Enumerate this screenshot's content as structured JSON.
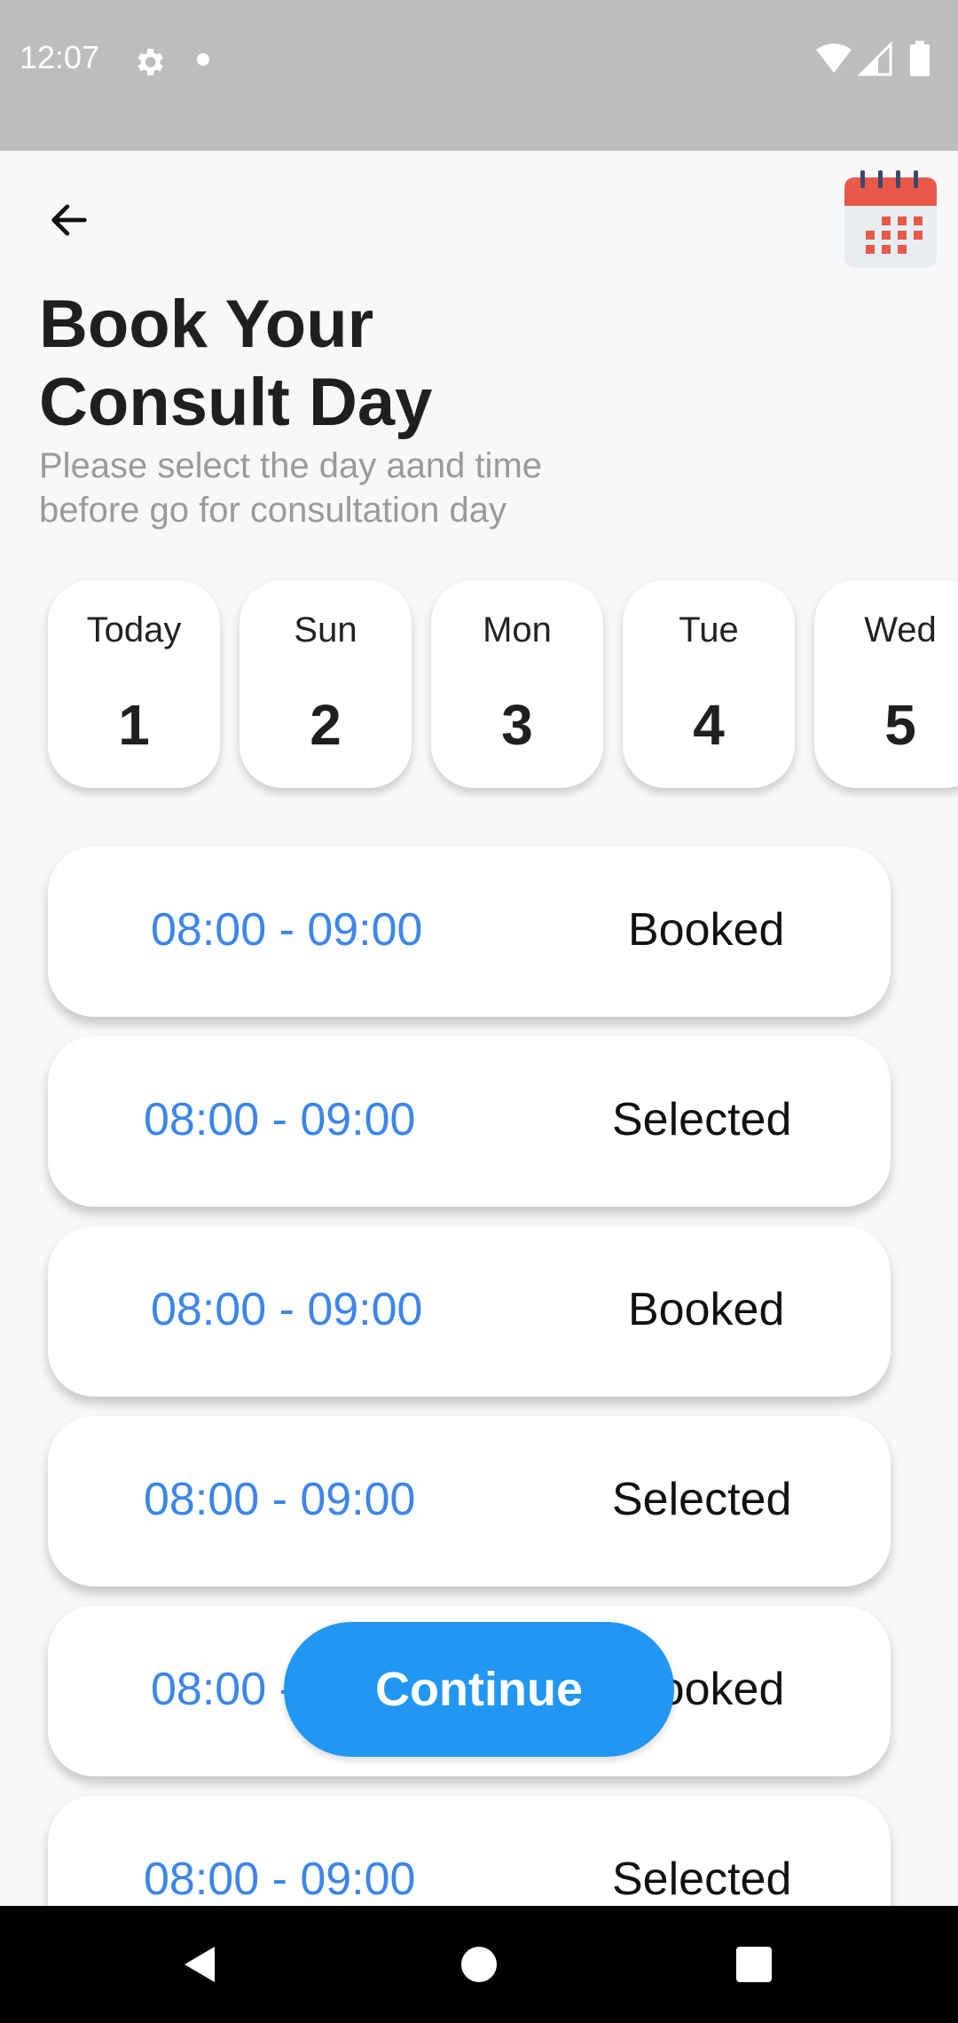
{
  "status_bar": {
    "time": "12:07",
    "icons": [
      "gear-icon",
      "notification-dot",
      "wifi-icon",
      "cell-signal-icon",
      "battery-icon"
    ]
  },
  "header": {
    "back_icon": "arrow-left-icon",
    "calendar_icon": "calendar-icon",
    "title_line1": "Book Your",
    "title_line2": "Consult Day",
    "subtitle_line1": "Please select the day aand time",
    "subtitle_line2": "before go for consultation day"
  },
  "days": [
    {
      "name": "Today",
      "number": "1"
    },
    {
      "name": "Sun",
      "number": "2"
    },
    {
      "name": "Mon",
      "number": "3"
    },
    {
      "name": "Tue",
      "number": "4"
    },
    {
      "name": "Wed",
      "number": "5"
    }
  ],
  "slots": [
    {
      "time": "08:00 - 09:00",
      "status": "Booked"
    },
    {
      "time": "08:00 - 09:00",
      "status": "Selected"
    },
    {
      "time": "08:00 - 09:00",
      "status": "Booked"
    },
    {
      "time": "08:00 - 09:00",
      "status": "Selected"
    },
    {
      "time": "08:00 - 09:00",
      "status": "Booked"
    },
    {
      "time": "08:00 - 09:00",
      "status": "Selected"
    }
  ],
  "continue_label": "Continue",
  "colors": {
    "accent": "#2196f3",
    "time_text": "#3d86e8",
    "calendar_red": "#e8594a",
    "status_bar": "#bdbdbd"
  },
  "nav": {
    "icons": [
      "back-triangle-icon",
      "home-circle-icon",
      "recents-square-icon"
    ]
  }
}
